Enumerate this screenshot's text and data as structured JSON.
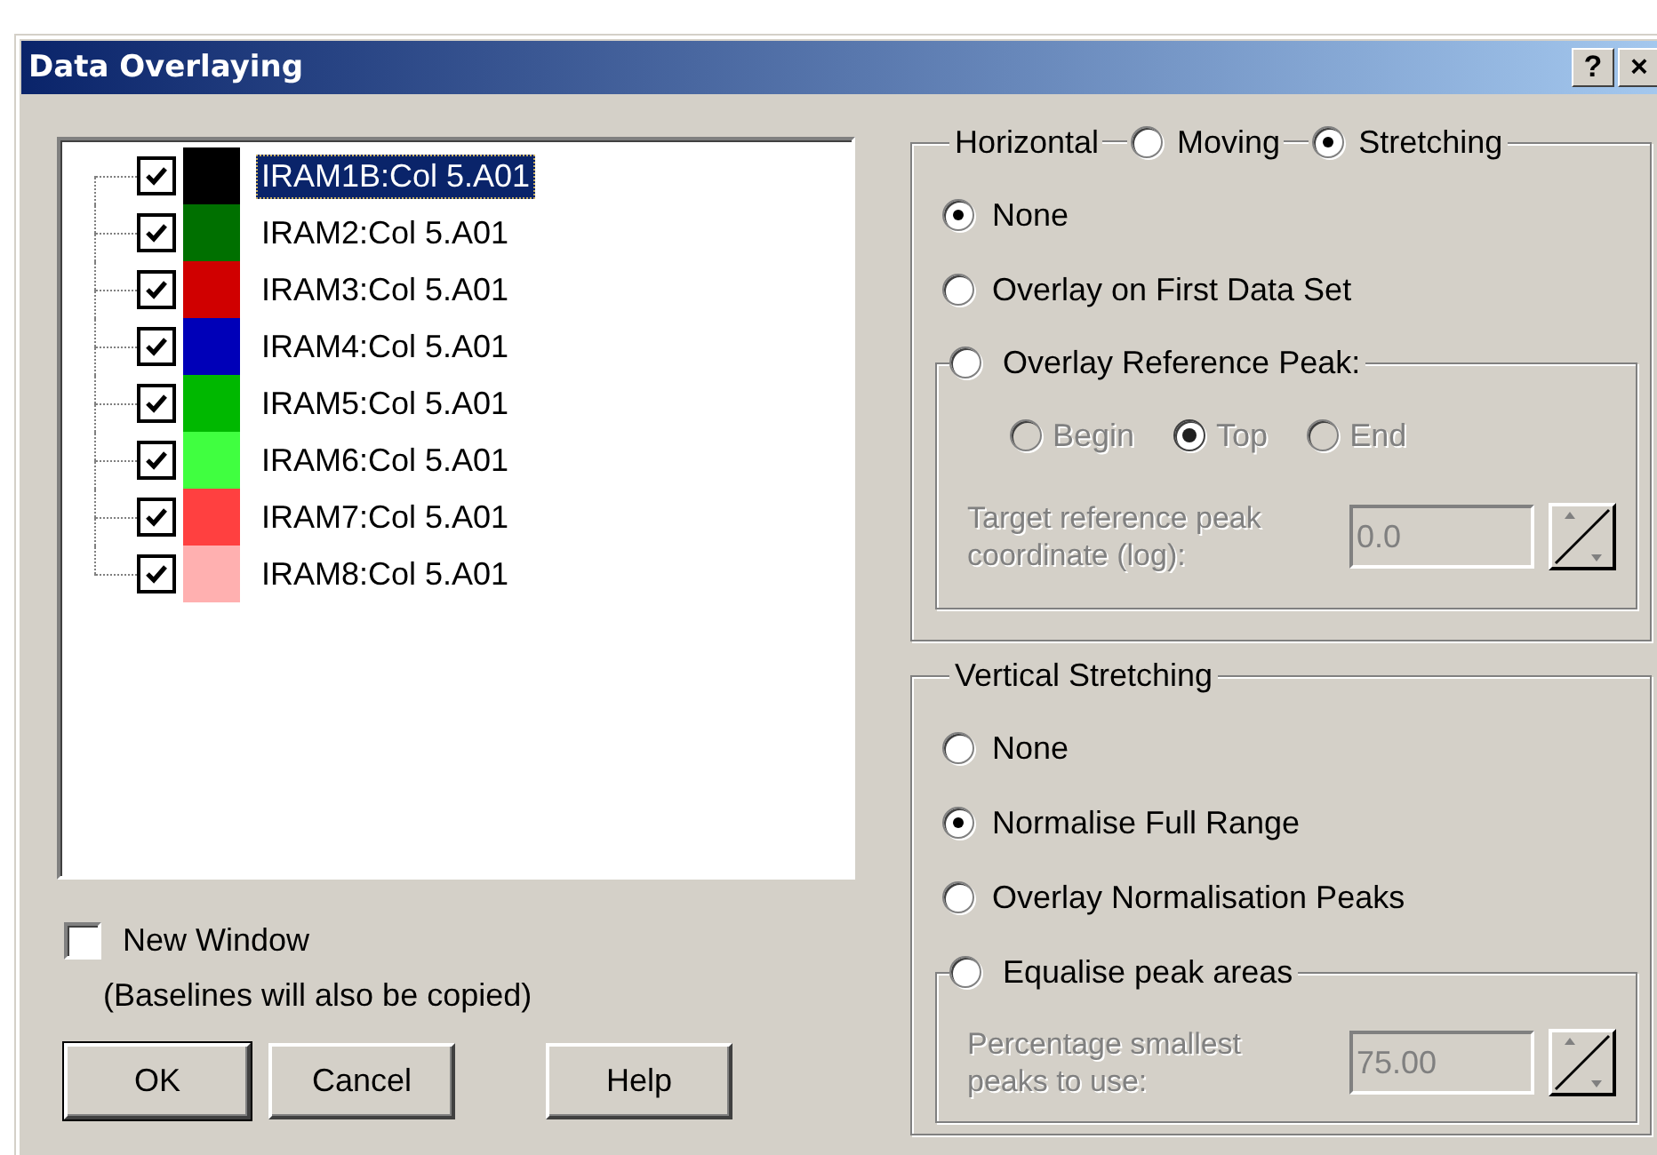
{
  "window": {
    "title": "Data Overlaying",
    "controls": [
      "?",
      "×"
    ]
  },
  "data_sets": [
    {
      "label": "IRAM1B:Col 5.A01",
      "checked": true,
      "color": "#000000",
      "selected": true
    },
    {
      "label": "IRAM2:Col 5.A01",
      "checked": true,
      "color": "#007000",
      "selected": false
    },
    {
      "label": "IRAM3:Col 5.A01",
      "checked": true,
      "color": "#d00000",
      "selected": false
    },
    {
      "label": "IRAM4:Col 5.A01",
      "checked": true,
      "color": "#0000b8",
      "selected": false
    },
    {
      "label": "IRAM5:Col 5.A01",
      "checked": true,
      "color": "#00b800",
      "selected": false
    },
    {
      "label": "IRAM6:Col 5.A01",
      "checked": true,
      "color": "#40ff40",
      "selected": false
    },
    {
      "label": "IRAM7:Col 5.A01",
      "checked": true,
      "color": "#ff4040",
      "selected": false
    },
    {
      "label": "IRAM8:Col 5.A01",
      "checked": true,
      "color": "#ffb0b0",
      "selected": false
    }
  ],
  "new_window": {
    "label": "New Window",
    "checked": false,
    "note": "(Baselines will also be copied)"
  },
  "buttons": [
    {
      "label": "OK",
      "default": true
    },
    {
      "label": "Cancel",
      "default": false
    },
    {
      "label": "Help",
      "default": false
    }
  ],
  "horizontal": {
    "title": "Horizontal",
    "modes": [
      {
        "label": "Moving",
        "selected": false
      },
      {
        "label": "Stretching",
        "selected": true
      }
    ],
    "options": [
      {
        "label": "None",
        "selected": true
      },
      {
        "label": "Overlay on First Data Set",
        "selected": false
      }
    ],
    "reference_group": {
      "label": "Overlay Reference Peak:",
      "selected": false,
      "disabled": true,
      "positions": [
        {
          "label": "Begin",
          "selected": false
        },
        {
          "label": "Top",
          "selected": true
        },
        {
          "label": "End",
          "selected": false
        }
      ],
      "field_label": "Target reference peak coordinate (log):",
      "value": "0.0"
    }
  },
  "vertical": {
    "title": "Vertical Stretching",
    "options": [
      {
        "label": "None",
        "selected": false
      },
      {
        "label": "Normalise Full Range",
        "selected": true
      },
      {
        "label": "Overlay Normalisation Peaks",
        "selected": false
      }
    ],
    "equalise_group": {
      "label": "Equalise peak areas",
      "selected": false,
      "disabled": true,
      "field_label": "Percentage smallest peaks to use:",
      "value": "75.00"
    }
  }
}
